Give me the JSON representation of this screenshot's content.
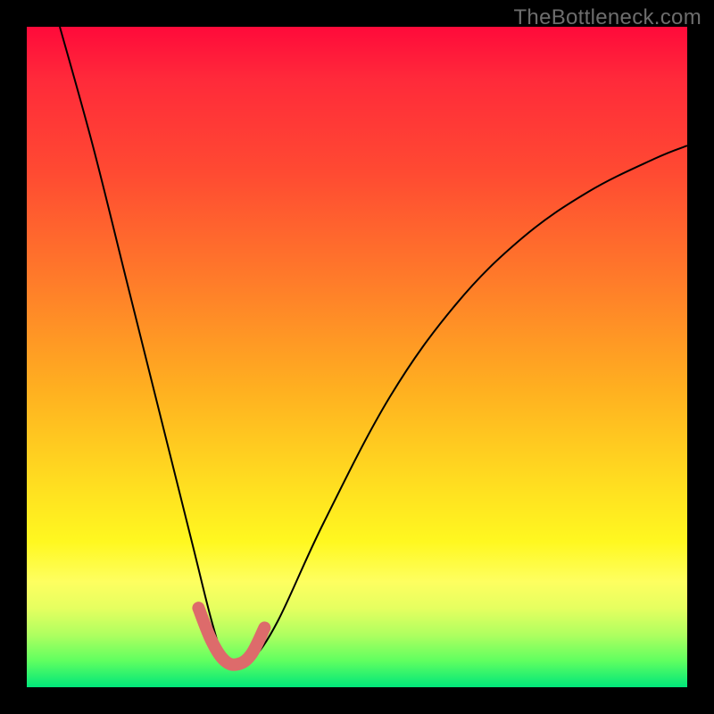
{
  "watermark": "TheBottleneck.com",
  "chart_data": {
    "type": "line",
    "title": "",
    "xlabel": "",
    "ylabel": "",
    "xlim": [
      0,
      100
    ],
    "ylim": [
      0,
      100
    ],
    "grid": false,
    "legend": null,
    "annotations": [],
    "background_gradient": {
      "direction": "vertical",
      "stops": [
        {
          "pos": 0,
          "color": "#ff0a3a"
        },
        {
          "pos": 22,
          "color": "#ff4a32"
        },
        {
          "pos": 55,
          "color": "#ffb020"
        },
        {
          "pos": 78,
          "color": "#fff820"
        },
        {
          "pos": 96,
          "color": "#60ff60"
        },
        {
          "pos": 100,
          "color": "#00e67a"
        }
      ]
    },
    "series": [
      {
        "name": "bottleneck-curve",
        "x": [
          5,
          10,
          15,
          20,
          25,
          28,
          30,
          32,
          34,
          38,
          45,
          55,
          65,
          75,
          85,
          95,
          100
        ],
        "y": [
          100,
          82,
          62,
          42,
          22,
          10,
          4,
          3,
          4,
          10,
          25,
          44,
          58,
          68,
          75,
          80,
          82
        ]
      }
    ],
    "highlight": {
      "name": "optimal-trough",
      "x": [
        26,
        28,
        30,
        32,
        34,
        36
      ],
      "y": [
        12,
        7,
        4,
        3.5,
        5,
        9
      ],
      "color": "#dd6b6b"
    }
  }
}
